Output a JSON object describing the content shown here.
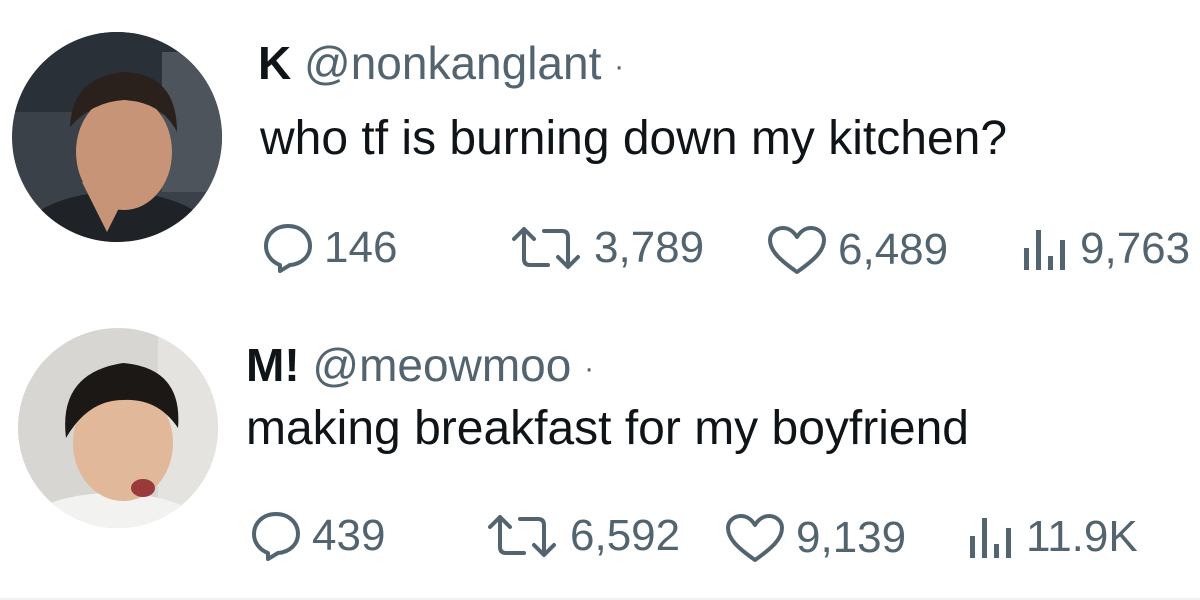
{
  "tweets": [
    {
      "display_name": "K",
      "handle": "@nonkanglant",
      "separator": "·",
      "text": "who tf is burning down my kitchen?",
      "avatar_icon": "profile-photo-avatar",
      "stats": {
        "replies": "146",
        "retweets": "3,789",
        "likes": "6,489",
        "views": "9,763"
      }
    },
    {
      "display_name": "M!",
      "handle": "@meowmoo",
      "separator": "·",
      "text": "making breakfast for my boyfriend",
      "avatar_icon": "profile-photo-avatar",
      "stats": {
        "replies": "439",
        "retweets": "6,592",
        "likes": "9,139",
        "views": "11.9K"
      }
    }
  ],
  "icons": {
    "reply": "speech-bubble-icon",
    "retweet": "retweet-arrows-icon",
    "like": "heart-outline-icon",
    "views": "bar-chart-icon"
  },
  "colors": {
    "text_primary": "#0f1419",
    "text_secondary": "#536471",
    "background": "#ffffff"
  }
}
